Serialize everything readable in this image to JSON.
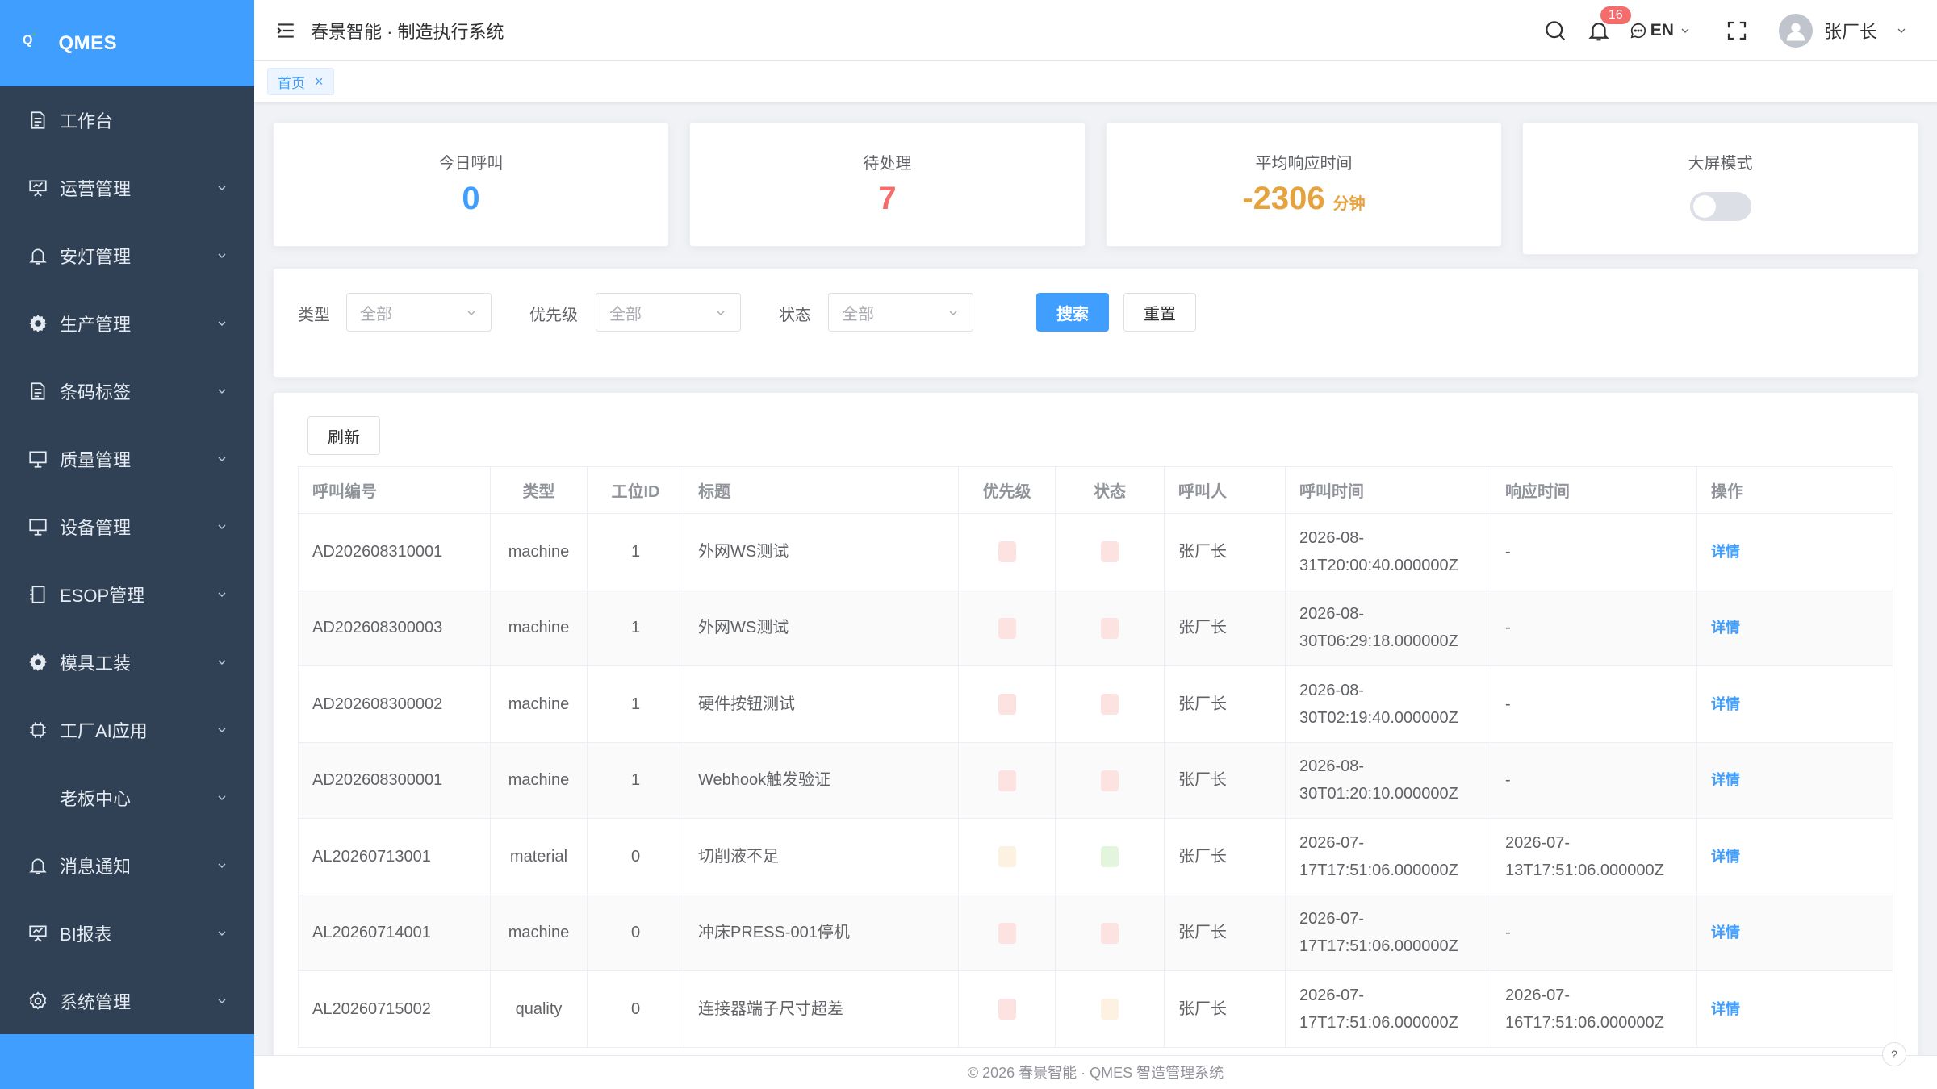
{
  "app": {
    "logo_mark": "Q",
    "logo_text": "QMES",
    "system_title": "春景智能 · 制造执行系统"
  },
  "sidebar": {
    "items": [
      {
        "label": "工作台",
        "icon": "document-icon"
      },
      {
        "label": "运营管理",
        "icon": "presentation-icon"
      },
      {
        "label": "安灯管理",
        "icon": "bell-icon"
      },
      {
        "label": "生产管理",
        "icon": "gear-icon"
      },
      {
        "label": "条码标签",
        "icon": "document-icon"
      },
      {
        "label": "质量管理",
        "icon": "monitor-icon"
      },
      {
        "label": "设备管理",
        "icon": "monitor-icon"
      },
      {
        "label": "ESOP管理",
        "icon": "notebook-icon"
      },
      {
        "label": "模具工装",
        "icon": "gear-icon"
      },
      {
        "label": "工厂AI应用",
        "icon": "chip-icon"
      },
      {
        "label": "老板中心",
        "icon": ""
      },
      {
        "label": "消息通知",
        "icon": "bell-icon"
      },
      {
        "label": "BI报表",
        "icon": "presentation-icon"
      },
      {
        "label": "系统管理",
        "icon": "settings-icon"
      }
    ]
  },
  "header": {
    "notification_count": "16",
    "language": "EN",
    "username": "张厂长"
  },
  "tags": {
    "home": "首页"
  },
  "stats": {
    "today_calls": {
      "label": "今日呼叫",
      "value": "0",
      "color": "#409eff"
    },
    "pending": {
      "label": "待处理",
      "value": "7",
      "color": "#f56c6c"
    },
    "avg_response": {
      "label": "平均响应时间",
      "value": "-2306",
      "unit": "分钟",
      "color": "#e6a23c"
    },
    "big_screen": {
      "label": "大屏模式",
      "enabled": false
    }
  },
  "filters": {
    "type_label": "类型",
    "type_value": "全部",
    "priority_label": "优先级",
    "priority_value": "全部",
    "status_label": "状态",
    "status_value": "全部",
    "search_button": "搜索",
    "reset_button": "重置"
  },
  "table": {
    "refresh_button": "刷新",
    "columns": [
      "呼叫编号",
      "类型",
      "工位ID",
      "标题",
      "优先级",
      "状态",
      "呼叫人",
      "呼叫时间",
      "响应时间",
      "操作"
    ],
    "rows": [
      {
        "id": "AD202608310001",
        "type": "machine",
        "station": "1",
        "title": "外网WS测试",
        "priority_color": "#fde2e2",
        "status_color": "#fde2e2",
        "caller": "张厂长",
        "call_time_1": "2026-08-",
        "call_time_2": "31T20:00:40.000000Z",
        "resp_time_1": "-",
        "resp_time_2": "",
        "action": "详情"
      },
      {
        "id": "AD202608300003",
        "type": "machine",
        "station": "1",
        "title": "外网WS测试",
        "priority_color": "#fde2e2",
        "status_color": "#fde2e2",
        "caller": "张厂长",
        "call_time_1": "2026-08-",
        "call_time_2": "30T06:29:18.000000Z",
        "resp_time_1": "-",
        "resp_time_2": "",
        "action": "详情"
      },
      {
        "id": "AD202608300002",
        "type": "machine",
        "station": "1",
        "title": "硬件按钮测试",
        "priority_color": "#fde2e2",
        "status_color": "#fde2e2",
        "caller": "张厂长",
        "call_time_1": "2026-08-",
        "call_time_2": "30T02:19:40.000000Z",
        "resp_time_1": "-",
        "resp_time_2": "",
        "action": "详情"
      },
      {
        "id": "AD202608300001",
        "type": "machine",
        "station": "1",
        "title": "Webhook触发验证",
        "priority_color": "#fde2e2",
        "status_color": "#fde2e2",
        "caller": "张厂长",
        "call_time_1": "2026-08-",
        "call_time_2": "30T01:20:10.000000Z",
        "resp_time_1": "-",
        "resp_time_2": "",
        "action": "详情"
      },
      {
        "id": "AL20260713001",
        "type": "material",
        "station": "0",
        "title": "切削液不足",
        "priority_color": "#fdf1e1",
        "status_color": "#e3f5dc",
        "caller": "张厂长",
        "call_time_1": "2026-07-",
        "call_time_2": "17T17:51:06.000000Z",
        "resp_time_1": "2026-07-",
        "resp_time_2": "13T17:51:06.000000Z",
        "action": "详情"
      },
      {
        "id": "AL20260714001",
        "type": "machine",
        "station": "0",
        "title": "冲床PRESS-001停机",
        "priority_color": "#fde2e2",
        "status_color": "#fde2e2",
        "caller": "张厂长",
        "call_time_1": "2026-07-",
        "call_time_2": "17T17:51:06.000000Z",
        "resp_time_1": "-",
        "resp_time_2": "",
        "action": "详情"
      },
      {
        "id": "AL20260715002",
        "type": "quality",
        "station": "0",
        "title": "连接器端子尺寸超差",
        "priority_color": "#fde2e2",
        "status_color": "#fdf1e1",
        "caller": "张厂长",
        "call_time_1": "2026-07-",
        "call_time_2": "17T17:51:06.000000Z",
        "resp_time_1": "2026-07-",
        "resp_time_2": "16T17:51:06.000000Z",
        "action": "详情"
      }
    ]
  },
  "footer": {
    "text": "© 2026 春景智能 · QMES 智造管理系统"
  }
}
